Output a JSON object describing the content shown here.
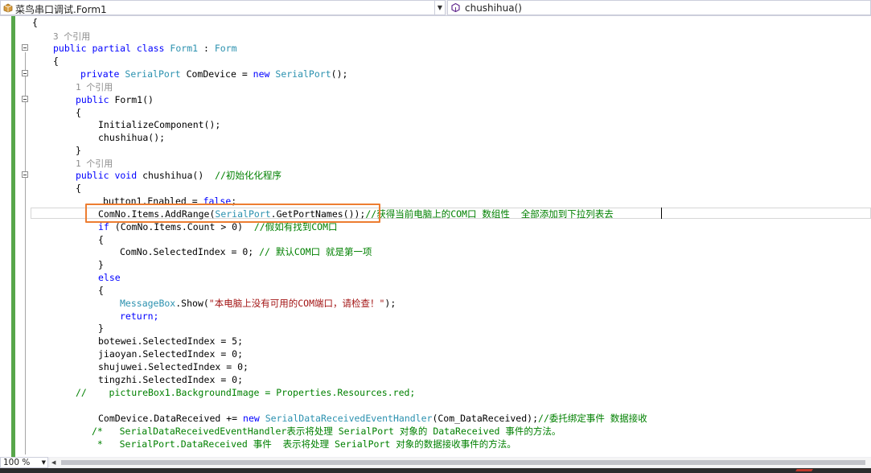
{
  "navbar": {
    "class_dropdown": "菜鸟串口调试.Form1",
    "member_dropdown": "chushihua()"
  },
  "code": {
    "l0": "{",
    "l1": "3 个引用",
    "l2_kw1": "public partial class",
    "l2_ty1": "Form1",
    "l2_sep": " : ",
    "l2_ty2": "Form",
    "l3": "{",
    "l4_kw": "private",
    "l4_ty": "SerialPort",
    "l4_mid": " ComDevice = ",
    "l4_kw2": "new",
    "l4_ty2": "SerialPort",
    "l4_end": "();",
    "l5": "1 个引用",
    "l6_kw": "public",
    "l6_rest": " Form1()",
    "l7": "{",
    "l8": "InitializeComponent();",
    "l9": "chushihua();",
    "l10": "}",
    "l11": "1 个引用",
    "l12_kw": "public void",
    "l12_rest": " chushihua()  ",
    "l12_cm": "//初始化化程序",
    "l13": "{",
    "l14_a": "button1.Enabled = ",
    "l14_kw": "false",
    "l14_b": ";",
    "l15_a": "ComNo.Items.AddRange(",
    "l15_ty": "SerialPort",
    "l15_b": ".GetPortNames());",
    "l15_cm": "//获得当前电脑上的COM口 数组性  全部添加到下拉列表去",
    "l16_kw": "if",
    "l16_a": " (ComNo.Items.Count > 0)  ",
    "l16_cm": "//假如有找到COM口",
    "l17": "{",
    "l18_a": "ComNo.SelectedIndex = 0; ",
    "l18_cm": "// 默认COM口 就是第一项",
    "l19": "}",
    "l20": "else",
    "l21": "{",
    "l22_ty": "MessageBox",
    "l22_a": ".Show(",
    "l22_st": "\"本电脑上没有可用的COM端口，请检查！\"",
    "l22_b": ");",
    "l23": "return;",
    "l24": "}",
    "l25": "botewei.SelectedIndex = 5;",
    "l26": "jiaoyan.SelectedIndex = 0;",
    "l27": "shujuwei.SelectedIndex = 0;",
    "l28": "tingzhi.SelectedIndex = 0;",
    "l29": "//    pictureBox1.BackgroundImage = Properties.Resources.red;",
    "l31_a": "ComDevice.DataReceived += ",
    "l31_kw": "new",
    "l31_ty": "SerialDataReceivedEventHandler",
    "l31_b": "(Com_DataReceived);",
    "l31_cm": "//委托绑定事件 数据接收",
    "l32": "/*   SerialDataReceivedEventHandler表示将处理 SerialPort 对象的 DataReceived 事件的方法。",
    "l33": " *   SerialPort.DataReceived 事件  表示将处理 SerialPort 对象的数据接收事件的方法。"
  },
  "status": {
    "zoom": "100 %"
  },
  "colors": {
    "keyword": "#0000ff",
    "type": "#2b91af",
    "comment": "#008000",
    "string": "#a31515",
    "highlight_box": "#ed7d31"
  }
}
